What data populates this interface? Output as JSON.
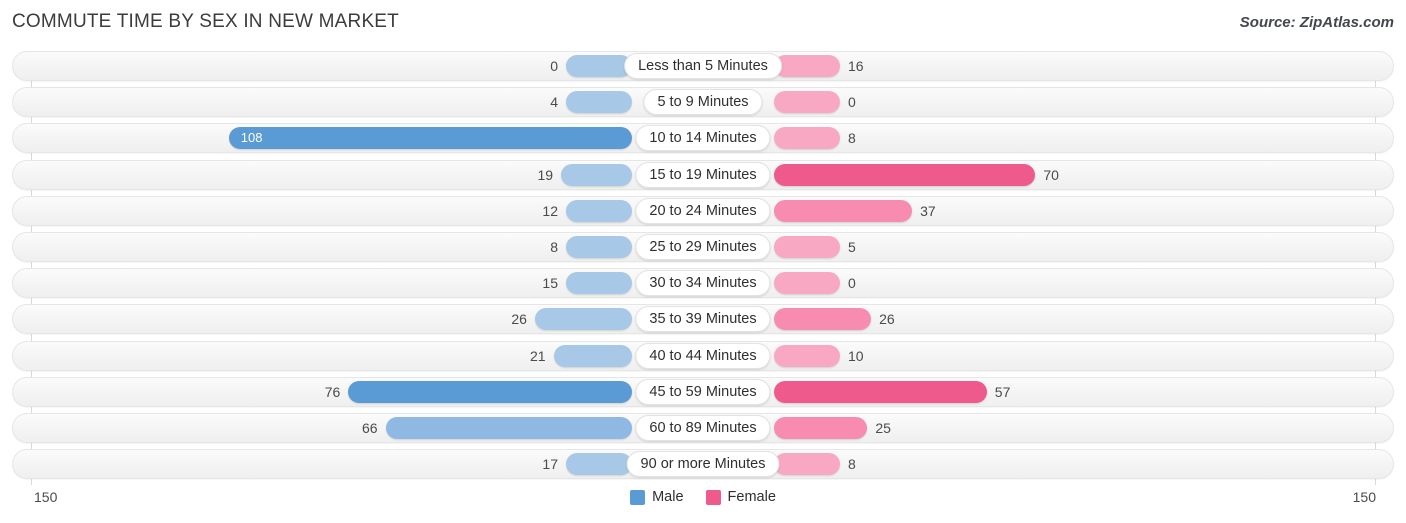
{
  "header": {
    "title": "COMMUTE TIME BY SEX IN NEW MARKET",
    "source": "Source: ZipAtlas.com"
  },
  "axis": {
    "left_label": "150",
    "right_label": "150",
    "max": 150
  },
  "legend": {
    "items": [
      {
        "label": "Male",
        "color": "#5b9bd5"
      },
      {
        "label": "Female",
        "color": "#ef5a8c"
      }
    ]
  },
  "colors": {
    "male_light": "#a8c8e8",
    "male_mid": "#8fb9e3",
    "male_dark": "#5b9bd5",
    "female_light": "#f9a8c4",
    "female_mid": "#f78cb0",
    "female_dark": "#ef5a8c",
    "track": "#f4f4f4",
    "gridline": "#d9d9d9"
  },
  "chart_data": {
    "type": "bar",
    "orientation": "horizontal-diverging",
    "title": "COMMUTE TIME BY SEX IN NEW MARKET",
    "xlabel": "",
    "ylabel": "",
    "xlim": [
      150,
      150
    ],
    "axis_max": 150,
    "grid": true,
    "legend_position": "bottom-center",
    "categories": [
      "Less than 5 Minutes",
      "5 to 9 Minutes",
      "10 to 14 Minutes",
      "15 to 19 Minutes",
      "20 to 24 Minutes",
      "25 to 29 Minutes",
      "30 to 34 Minutes",
      "35 to 39 Minutes",
      "40 to 44 Minutes",
      "45 to 59 Minutes",
      "60 to 89 Minutes",
      "90 or more Minutes"
    ],
    "series": [
      {
        "name": "Male",
        "color": "#5b9bd5",
        "values": [
          0,
          4,
          108,
          19,
          12,
          8,
          15,
          26,
          21,
          76,
          66,
          17
        ]
      },
      {
        "name": "Female",
        "color": "#ef5a8c",
        "values": [
          16,
          0,
          8,
          70,
          37,
          5,
          0,
          26,
          10,
          57,
          25,
          8
        ]
      }
    ],
    "rows": [
      {
        "category": "Less than 5 Minutes",
        "male": 0,
        "female": 16,
        "male_label": "0",
        "female_label": "16",
        "male_inside": false
      },
      {
        "category": "5 to 9 Minutes",
        "male": 4,
        "female": 0,
        "male_label": "4",
        "female_label": "0",
        "male_inside": false
      },
      {
        "category": "10 to 14 Minutes",
        "male": 108,
        "female": 8,
        "male_label": "108",
        "female_label": "8",
        "male_inside": true
      },
      {
        "category": "15 to 19 Minutes",
        "male": 19,
        "female": 70,
        "male_label": "19",
        "female_label": "70",
        "male_inside": false
      },
      {
        "category": "20 to 24 Minutes",
        "male": 12,
        "female": 37,
        "male_label": "12",
        "female_label": "37",
        "male_inside": false
      },
      {
        "category": "25 to 29 Minutes",
        "male": 8,
        "female": 5,
        "male_label": "8",
        "female_label": "5",
        "male_inside": false
      },
      {
        "category": "30 to 34 Minutes",
        "male": 15,
        "female": 0,
        "male_label": "15",
        "female_label": "0",
        "male_inside": false
      },
      {
        "category": "35 to 39 Minutes",
        "male": 26,
        "female": 26,
        "male_label": "26",
        "female_label": "26",
        "male_inside": false
      },
      {
        "category": "40 to 44 Minutes",
        "male": 21,
        "female": 10,
        "male_label": "21",
        "female_label": "10",
        "male_inside": false
      },
      {
        "category": "45 to 59 Minutes",
        "male": 76,
        "female": 57,
        "male_label": "76",
        "female_label": "57",
        "male_inside": false
      },
      {
        "category": "60 to 89 Minutes",
        "male": 66,
        "female": 25,
        "male_label": "66",
        "female_label": "25",
        "male_inside": false
      },
      {
        "category": "90 or more Minutes",
        "male": 17,
        "female": 8,
        "male_label": "17",
        "female_label": "8",
        "male_inside": false
      }
    ]
  }
}
